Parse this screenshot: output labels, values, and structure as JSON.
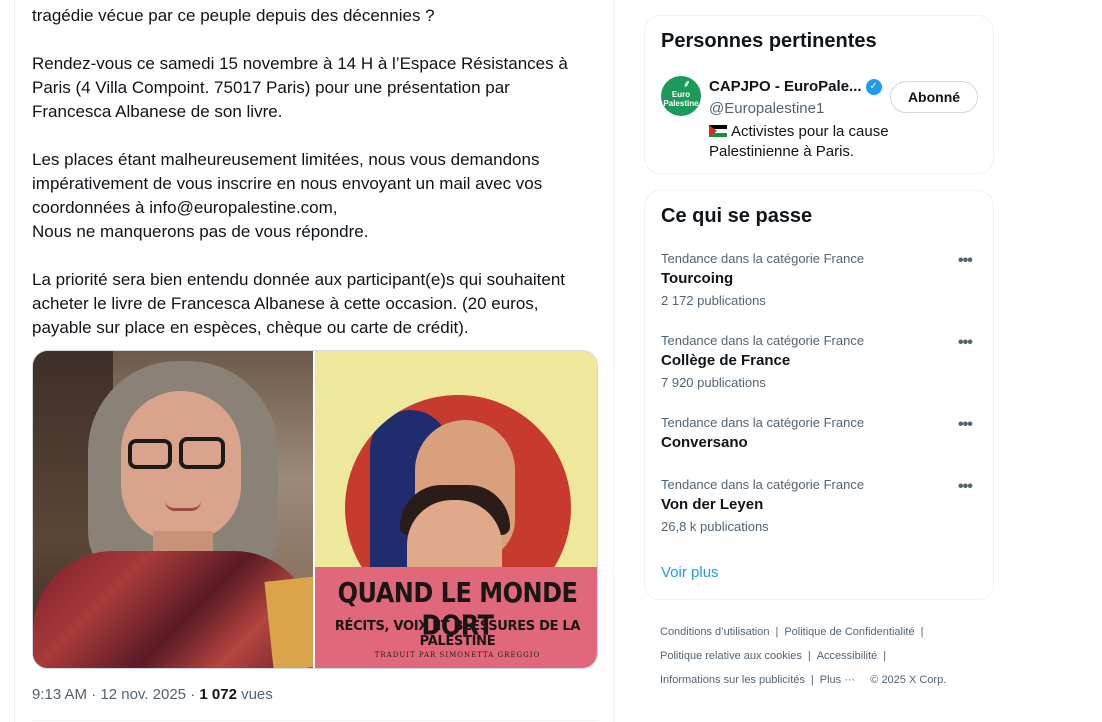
{
  "tweet": {
    "paragraphs": [
      "tragédie vécue par ce peuple depuis des décennies ?",
      "Rendez-vous ce samedi 15 novembre à 14 H à l’Espace Résistances à Paris (4 Villa Compoint. 75017 Paris) pour une présentation par Francesca Albanese de son livre.",
      "Les places étant malheureusement limitées, nous vous demandons impérativement de vous inscrire en nous envoyant un mail avec vos coordonnées à info@europalestine.com,",
      "Nous ne manquerons pas de vous répondre.",
      "La priorité sera bien entendu donnée aux participant(e)s qui souhaitent acheter le livre de Francesca Albanese à cette occasion. (20 euros, payable sur place en espèces, chèque ou carte de crédit)."
    ],
    "book": {
      "title": "QUAND LE MONDE DORT",
      "subtitle": "RÉCITS, VOIX ET BLESSURES DE LA PALESTINE",
      "translator": "TRADUIT PAR SIMONETTA GREGGIO"
    },
    "time": "9:13 AM",
    "date": "12 nov. 2025",
    "views_count": "1 072",
    "views_label": "vues"
  },
  "people_panel": {
    "title": "Personnes pertinentes",
    "avatar_text": "Euro Palestine",
    "name": "CAPJPO - EuroPale...",
    "handle": "@Europalestine1",
    "follow_label": "Abonné",
    "bio": "Activistes pour la cause Palestinienne à Paris."
  },
  "trends_panel": {
    "title": "Ce qui se passe",
    "items": [
      {
        "category": "Tendance dans la catégorie France",
        "name": "Tourcoing",
        "count": "2 172 publications"
      },
      {
        "category": "Tendance dans la catégorie France",
        "name": "Collège de France",
        "count": "7 920 publications"
      },
      {
        "category": "Tendance dans la catégorie France",
        "name": "Conversano",
        "count": ""
      },
      {
        "category": "Tendance dans la catégorie France",
        "name": "Von der Leyen",
        "count": "26,8 k publications"
      }
    ],
    "show_more": "Voir plus"
  },
  "footer": {
    "terms": "Conditions d’utilisation",
    "privacy": "Politique de Confidentialité",
    "cookies": "Politique relative aux cookies",
    "accessibility": "Accessibilité",
    "ads_info": "Informations sur les publicités",
    "more": "Plus ···",
    "copyright": "© 2025 X Corp."
  },
  "colors": {
    "accent": "#1d9bf0",
    "secondary_text": "#536471",
    "border": "#eff3f4"
  }
}
